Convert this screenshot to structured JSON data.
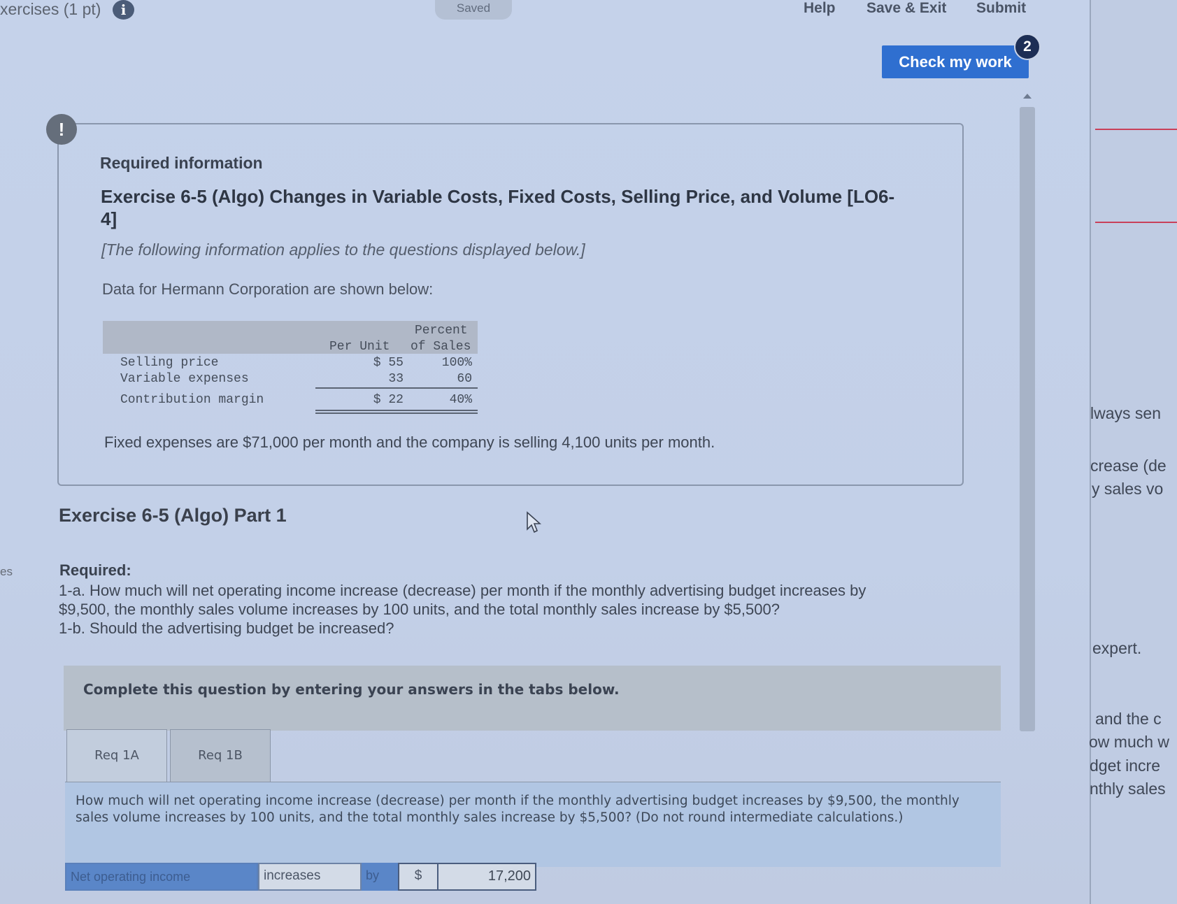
{
  "topbar": {
    "crumb": "xercises (1 pt)",
    "info_icon": "i",
    "saved": "Saved",
    "help": "Help",
    "save_exit": "Save & Exit",
    "submit": "Submit",
    "check_my_work": "Check my work",
    "badge_count": "2"
  },
  "info_box": {
    "alert_icon": "!",
    "required_information": "Required information",
    "exercise_title": "Exercise 6-5 (Algo) Changes in Variable Costs, Fixed Costs, Selling Price, and Volume [LO6-4]",
    "applies_note": "[The following information applies to the questions displayed below.]",
    "data_intro": "Data for Hermann Corporation are shown below:",
    "table": {
      "header_per_unit": "Per Unit",
      "header_percent_line1": "Percent",
      "header_percent_line2": "of Sales",
      "rows": [
        {
          "label": "Selling price",
          "per_unit": "$ 55",
          "percent": "100%"
        },
        {
          "label": "Variable expenses",
          "per_unit": "33",
          "percent": "60"
        },
        {
          "label": "Contribution margin",
          "per_unit": "$ 22",
          "percent": "40%"
        }
      ]
    },
    "fixed_expenses_text": "Fixed expenses are $71,000 per month and the company is selling 4,100 units per month."
  },
  "part": {
    "title": "Exercise 6-5 (Algo) Part 1",
    "side_label": "es",
    "required_label": "Required:",
    "req_lines": [
      "1-a. How much will net operating income increase (decrease) per month if the monthly advertising budget increases by",
      "$9,500, the monthly sales volume increases by 100 units, and the total monthly sales increase by $5,500?",
      "1-b. Should the advertising budget be increased?"
    ]
  },
  "tabs_section": {
    "instruction": "Complete this question by entering your answers in the tabs below.",
    "tabs": [
      {
        "label": "Req 1A"
      },
      {
        "label": "Req 1B"
      }
    ],
    "question_text": "How much will net operating income increase (decrease) per month if the monthly advertising budget increases by $9,500, the monthly sales volume increases by 100 units, and the total monthly sales increase by $5,500? (Do not round intermediate calculations.)",
    "answer": {
      "label": "Net operating income",
      "direction": "increases",
      "by": "by",
      "currency": "$",
      "value": "17,200"
    }
  },
  "right_panel": {
    "lines": [
      "lways sen",
      "crease (de",
      "y sales vo",
      "expert.",
      "and the c",
      "ow much w",
      "dget incre",
      "nthly sales"
    ]
  }
}
